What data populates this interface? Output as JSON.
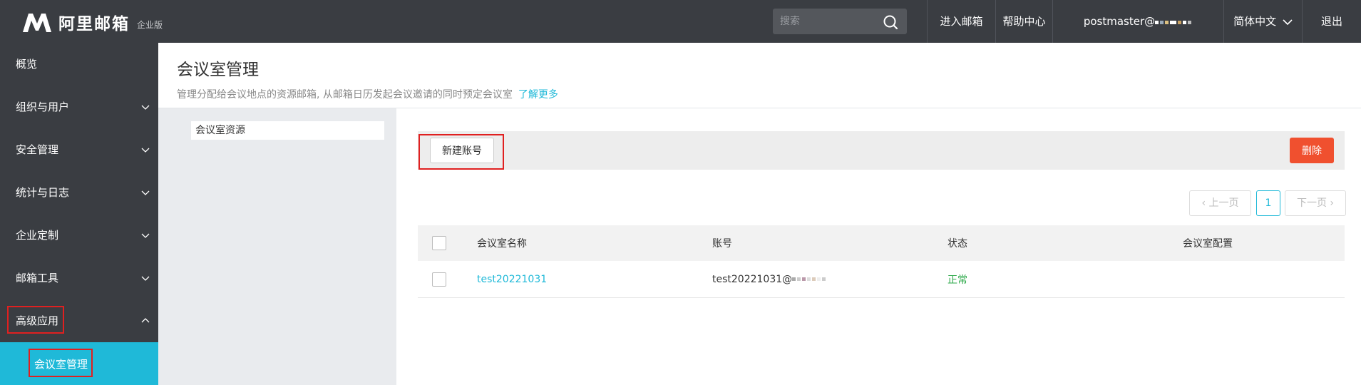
{
  "header": {
    "logo_text": "阿里邮箱",
    "logo_sub": "企业版",
    "search_placeholder": "搜索",
    "nav": [
      "进入邮箱",
      "帮助中心",
      "postmaster@",
      "简体中文",
      "退出"
    ]
  },
  "sidebar": {
    "items": [
      {
        "label": "概览"
      },
      {
        "label": "组织与用户"
      },
      {
        "label": "安全管理"
      },
      {
        "label": "统计与日志"
      },
      {
        "label": "企业定制"
      },
      {
        "label": "邮箱工具"
      },
      {
        "label": "高级应用"
      }
    ],
    "active_sub": "会议室管理"
  },
  "page": {
    "title": "会议室管理",
    "description": "管理分配给会议地点的资源邮箱, 从邮箱日历发起会议邀请的同时预定会议室",
    "learn_more": "了解更多"
  },
  "left_panel": {
    "item": "会议室资源"
  },
  "toolbar": {
    "new_label": "新建账号",
    "delete_label": "删除"
  },
  "pager": {
    "prev": "‹ 上一页",
    "current": "1",
    "next": "下一页 ›"
  },
  "table": {
    "columns": [
      "会议室名称",
      "账号",
      "状态",
      "会议室配置"
    ],
    "rows": [
      {
        "name": "test20221031",
        "account": "test20221031@",
        "status": "正常"
      }
    ]
  },
  "colors": {
    "accent": "#1fb9d8",
    "danger": "#f0502f",
    "ok": "#2eaa4b",
    "dark": "#3a3d42"
  }
}
